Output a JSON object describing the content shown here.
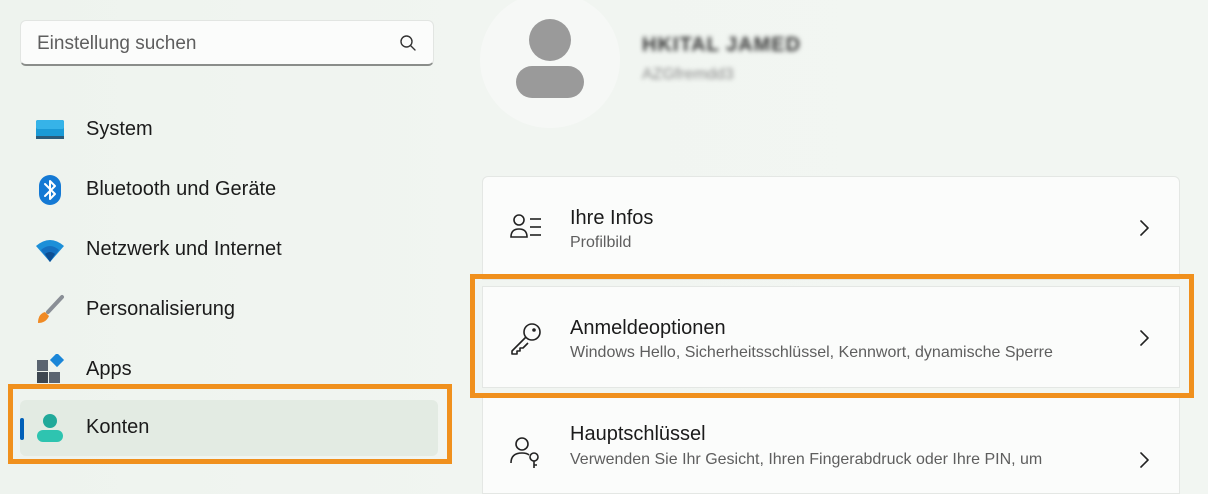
{
  "search": {
    "placeholder": "Einstellung suchen",
    "icon": "search-icon"
  },
  "sidebar": {
    "items": [
      {
        "label": "System",
        "icon": "monitor-icon",
        "active": false
      },
      {
        "label": "Bluetooth und Geräte",
        "icon": "bluetooth-icon",
        "active": false
      },
      {
        "label": "Netzwerk und Internet",
        "icon": "wifi-icon",
        "active": false
      },
      {
        "label": "Personalisierung",
        "icon": "brush-icon",
        "active": false
      },
      {
        "label": "Apps",
        "icon": "apps-icon",
        "active": false
      },
      {
        "label": "Konten",
        "icon": "person-icon",
        "active": true
      }
    ]
  },
  "profile": {
    "name": "HKITAL JAMED",
    "email": "AZGfremdd3"
  },
  "cards": [
    {
      "title": "Ihre Infos",
      "subtitle": "Profilbild",
      "icon": "profile-info-icon"
    },
    {
      "title": "Anmeldeoptionen",
      "subtitle": "Windows Hello, Sicherheitsschlüssel, Kennwort, dynamische Sperre",
      "icon": "key-icon"
    },
    {
      "title": "Hauptschlüssel",
      "subtitle": "Verwenden Sie Ihr Gesicht, Ihren Fingerabdruck oder Ihre PIN, um",
      "icon": "passkey-icon"
    }
  ],
  "colors": {
    "accent": "#005fb8",
    "highlight": "#f0901d"
  }
}
